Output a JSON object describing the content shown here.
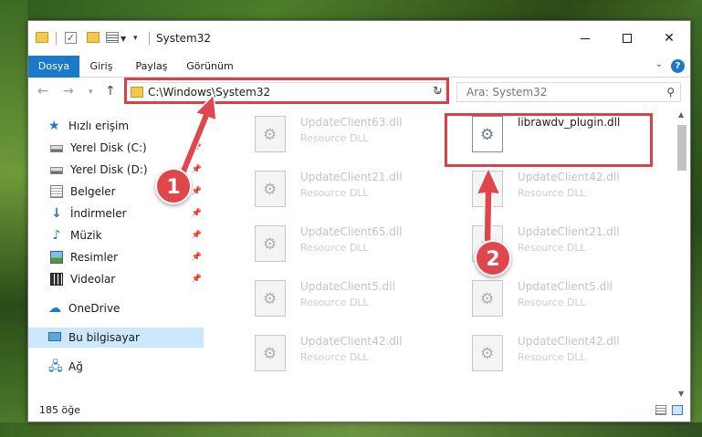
{
  "window": {
    "title": "System32"
  },
  "ribbon": {
    "tabs": [
      {
        "label": "Dosya"
      },
      {
        "label": "Giriş"
      },
      {
        "label": "Paylaş"
      },
      {
        "label": "Görünüm"
      }
    ],
    "help_label": "?"
  },
  "address": {
    "path": "C:\\Windows\\System32",
    "search_placeholder": "Ara: System32"
  },
  "navpane": {
    "items": [
      {
        "label": "Hızlı erişim",
        "icon": "star-icon",
        "pinned": false
      },
      {
        "label": "Yerel Disk (C:)",
        "icon": "drive-icon",
        "pinned": true
      },
      {
        "label": "Yerel Disk (D:)",
        "icon": "drive-icon",
        "pinned": true
      },
      {
        "label": "Belgeler",
        "icon": "documents-icon",
        "pinned": true
      },
      {
        "label": "İndirmeler",
        "icon": "download-icon",
        "pinned": true
      },
      {
        "label": "Müzik",
        "icon": "music-icon",
        "pinned": true
      },
      {
        "label": "Resimler",
        "icon": "pictures-icon",
        "pinned": true
      },
      {
        "label": "Videolar",
        "icon": "videos-icon",
        "pinned": true
      },
      {
        "label": "OneDrive",
        "icon": "cloud-icon",
        "pinned": false
      },
      {
        "label": "Bu bilgisayar",
        "icon": "computer-icon",
        "pinned": false,
        "selected": true
      },
      {
        "label": "Ağ",
        "icon": "network-icon",
        "pinned": false
      }
    ]
  },
  "files": [
    {
      "name": "UpdateClient63.dll",
      "type": "Resource DLL"
    },
    {
      "name": "librawdv_plugin.dll",
      "type": ""
    },
    {
      "name": "UpdateClient21.dll",
      "type": "Resource DLL"
    },
    {
      "name": "UpdateClient42.dll",
      "type": "Resource DLL"
    },
    {
      "name": "UpdateClient65.dll",
      "type": "Resource DLL"
    },
    {
      "name": "UpdateClient21.dll",
      "type": "Resource DLL"
    },
    {
      "name": "UpdateClient5.dll",
      "type": "Resource DLL"
    },
    {
      "name": "UpdateClient5.dll",
      "type": "Resource DLL"
    },
    {
      "name": "UpdateClient42.dll",
      "type": "Resource DLL"
    },
    {
      "name": "UpdateClient42.dll",
      "type": "Resource DLL"
    }
  ],
  "status": {
    "item_count": "185 öğe"
  },
  "annotations": {
    "step1": "1",
    "step2": "2",
    "color": "#e0474d"
  },
  "colors": {
    "accent": "#1979ca",
    "selection": "#cce8ff"
  }
}
